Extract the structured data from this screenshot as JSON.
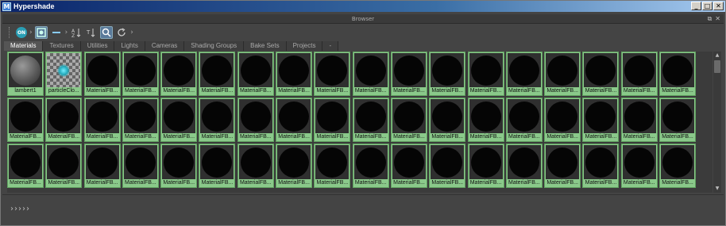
{
  "window": {
    "title": "Hypershade",
    "app_icon": "M",
    "controls": [
      "_",
      "□",
      "✕"
    ]
  },
  "panel": {
    "title": "Browser",
    "ctrls": [
      "⧉",
      "✕"
    ]
  },
  "toolbar": {
    "on_label": "ON",
    "buttons": [
      {
        "icon": "sort-icon",
        "glyph": "⇅"
      },
      {
        "icon": "list-icon",
        "glyph": "☰"
      },
      {
        "icon": "view-icon",
        "glyph": "▣"
      },
      {
        "icon": "refresh-icon",
        "glyph": "⟳"
      }
    ]
  },
  "tabs": [
    "Materials",
    "Textures",
    "Utilities",
    "Lights",
    "Cameras",
    "Shading Groups",
    "Bake Sets",
    "Projects",
    "-"
  ],
  "active_tab": "Materials",
  "swatches_row1": [
    "lambert1",
    "particleClo...",
    "MaterialFB...",
    "MaterialFB...",
    "MaterialFB...",
    "MaterialFB...",
    "MaterialFB...",
    "MaterialFB...",
    "MaterialFB...",
    "MaterialFB...",
    "MaterialFB...",
    "MaterialFB...",
    "MaterialFB...",
    "MaterialFB...",
    "MaterialFB...",
    "MaterialFB...",
    "MaterialFB...",
    "MaterialFB..."
  ],
  "swatches_row2": [
    "MaterialFB...",
    "MaterialFB...",
    "MaterialFB...",
    "MaterialFB...",
    "MaterialFB...",
    "MaterialFB...",
    "MaterialFB...",
    "MaterialFB...",
    "MaterialFB...",
    "MaterialFB...",
    "MaterialFB...",
    "MaterialFB...",
    "MaterialFB...",
    "MaterialFB...",
    "MaterialFB...",
    "MaterialFB...",
    "MaterialFB...",
    "MaterialFB..."
  ],
  "swatches_row3": [
    "MaterialFB...",
    "MaterialFB...",
    "MaterialFB...",
    "MaterialFB...",
    "MaterialFB...",
    "MaterialFB...",
    "MaterialFB...",
    "MaterialFB...",
    "MaterialFB...",
    "MaterialFB...",
    "MaterialFB...",
    "MaterialFB...",
    "MaterialFB...",
    "MaterialFB...",
    "MaterialFB...",
    "MaterialFB...",
    "MaterialFB...",
    "MaterialFB..."
  ],
  "colors": {
    "swatch_bg": "#8ac98a",
    "titlebar": "#0a246a",
    "panel_bg": "#444444"
  }
}
